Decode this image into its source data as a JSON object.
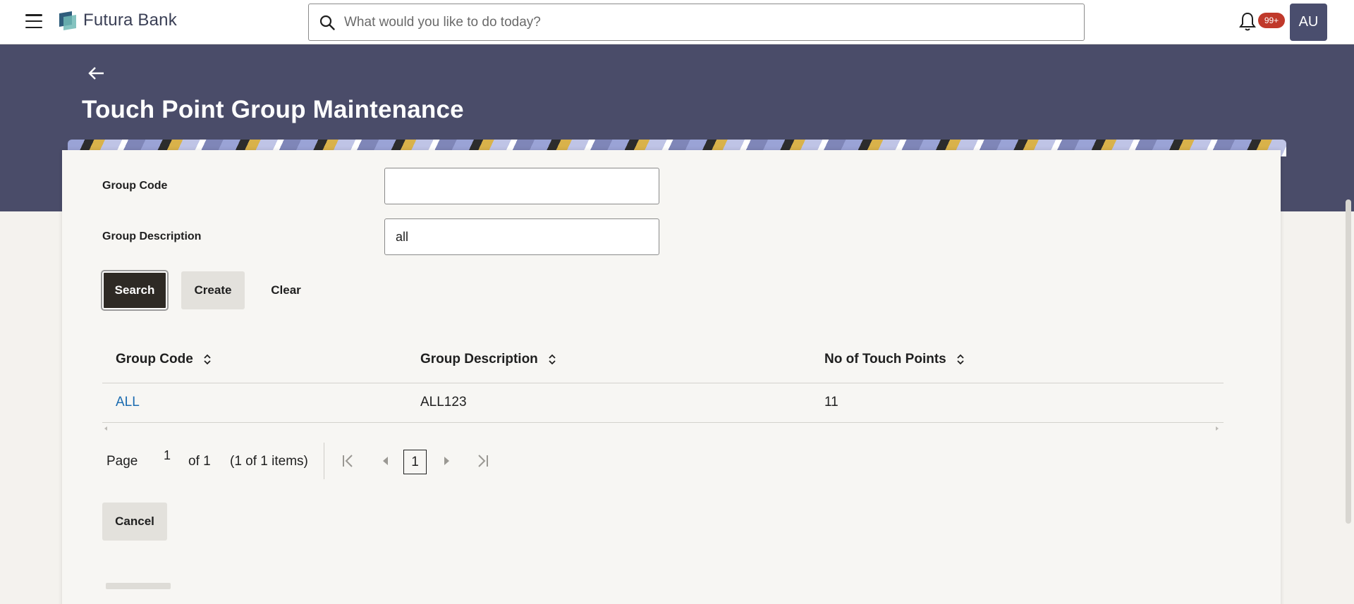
{
  "header": {
    "brand": "Futura Bank",
    "search_placeholder": "What would you like to do today?",
    "notification_count": "99+",
    "avatar_initials": "AU"
  },
  "page": {
    "title": "Touch Point Group Maintenance"
  },
  "form": {
    "group_code_label": "Group Code",
    "group_code_value": "",
    "group_description_label": "Group Description",
    "group_description_value": "all"
  },
  "actions": {
    "search": "Search",
    "create": "Create",
    "clear": "Clear",
    "cancel": "Cancel"
  },
  "table": {
    "columns": [
      "Group Code",
      "Group Description",
      "No of Touch Points"
    ],
    "rows": [
      {
        "group_code": "ALL",
        "group_description": "ALL123",
        "touch_points": "11"
      }
    ]
  },
  "pagination": {
    "page_label": "Page",
    "current_page": "1",
    "of_label": "of 1",
    "items_label": "(1 of 1 items)",
    "page_button": "1"
  },
  "colors": {
    "banner": "#4a4c69",
    "primary_button": "#2e2a25",
    "link": "#1a6bb0",
    "badge": "#c0392b",
    "avatar": "#4a4e6e"
  },
  "icons": [
    "menu-icon",
    "bank-logo-icon",
    "search-icon",
    "bell-icon",
    "back-arrow-icon",
    "sort-icon",
    "first-page-icon",
    "prev-page-icon",
    "next-page-icon",
    "last-page-icon"
  ]
}
